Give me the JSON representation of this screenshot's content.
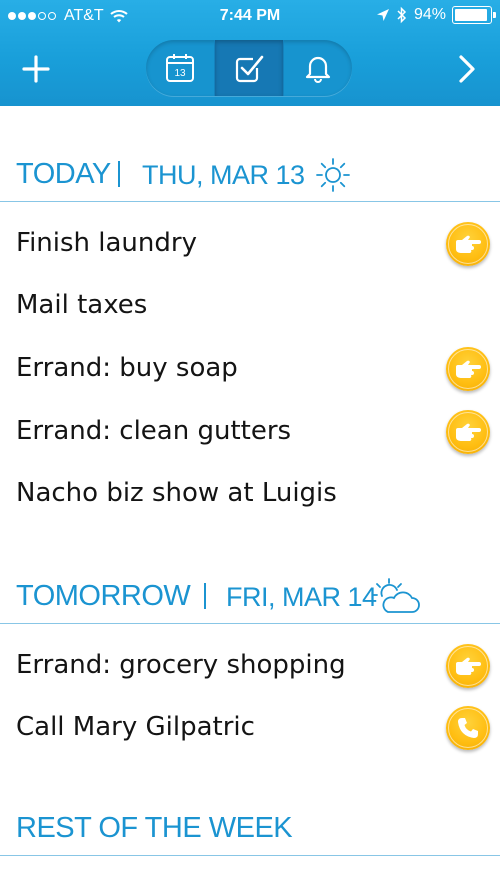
{
  "status_bar": {
    "carrier": "AT&T",
    "time": "7:44 PM",
    "battery_percent": "94%",
    "battery_level": 0.94,
    "signal_dots_filled": 3,
    "signal_dots_total": 5
  },
  "toolbar": {
    "left_icon": "plus-icon",
    "right_icon": "chevron-right-icon",
    "segments": [
      {
        "icon": "calendar-icon",
        "label": "13",
        "active": false
      },
      {
        "icon": "checkbox-icon",
        "active": true
      },
      {
        "icon": "bell-icon",
        "active": false
      }
    ]
  },
  "sections": {
    "today": {
      "title": "TODAY",
      "date": "THU, MAR 13",
      "weather_icon": "sun-icon",
      "tasks": [
        {
          "text": "Finish laundry",
          "action_icon": "pointing-hand-icon"
        },
        {
          "text": "Mail taxes"
        },
        {
          "text": "Errand: buy soap",
          "action_icon": "pointing-hand-icon"
        },
        {
          "text": "Errand: clean gutters",
          "action_icon": "pointing-hand-icon"
        },
        {
          "text": "Nacho biz show at Luigis"
        }
      ]
    },
    "tomorrow": {
      "title": "TOMORROW",
      "date": "FRI, MAR 14",
      "weather_icon": "partly-cloudy-icon",
      "tasks": [
        {
          "text": "Errand: grocery shopping",
          "action_icon": "pointing-hand-icon"
        },
        {
          "text": "Call Mary Gilpatric",
          "action_icon": "phone-icon"
        }
      ]
    },
    "rest_of_week": {
      "title": "REST OF THE WEEK"
    }
  },
  "colors": {
    "header_blue": "#1ba1dc",
    "accent_blue": "#1b94d1",
    "badge_yellow": "#ffbe12"
  }
}
